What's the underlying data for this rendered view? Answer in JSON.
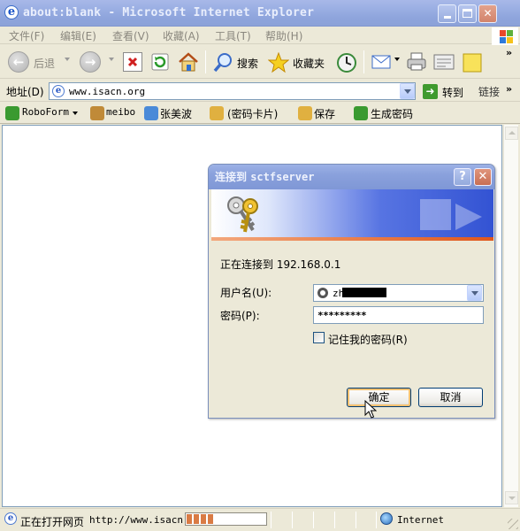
{
  "window": {
    "title": "about:blank - Microsoft Internet Explorer"
  },
  "menu": [
    "文件(F)",
    "编辑(E)",
    "查看(V)",
    "收藏(A)",
    "工具(T)",
    "帮助(H)"
  ],
  "toolbar": {
    "back_label": "后退",
    "search_label": "搜索",
    "favorites_label": "收藏夹"
  },
  "address": {
    "label": "地址(D)",
    "url": "www.isacn.org",
    "go_label": "转到",
    "links_label": "链接"
  },
  "linkbar": {
    "items": [
      "RoboForm",
      "meibo",
      "张美波",
      "(密码卡片)",
      "保存",
      "生成密码"
    ]
  },
  "status": {
    "text": "正在打开网页",
    "url": "http://www.isacn.",
    "progress_segments": 4,
    "zone": "Internet"
  },
  "dialog": {
    "title_prefix": "连接到",
    "server": "sctfserver",
    "connecting": "正在连接到 192.168.0.1",
    "username_label": "用户名(U):",
    "username_value": "zh",
    "password_label": "密码(P):",
    "password_value": "*********",
    "remember_label": "记住我的密码(R)",
    "remember_checked": false,
    "ok_label": "确定",
    "cancel_label": "取消"
  },
  "colors": {
    "titlebar": "#9cb0e4",
    "dialog_banner": "#3353d3",
    "banner_stripe": "#e0571b",
    "progress": "#d97b44"
  }
}
